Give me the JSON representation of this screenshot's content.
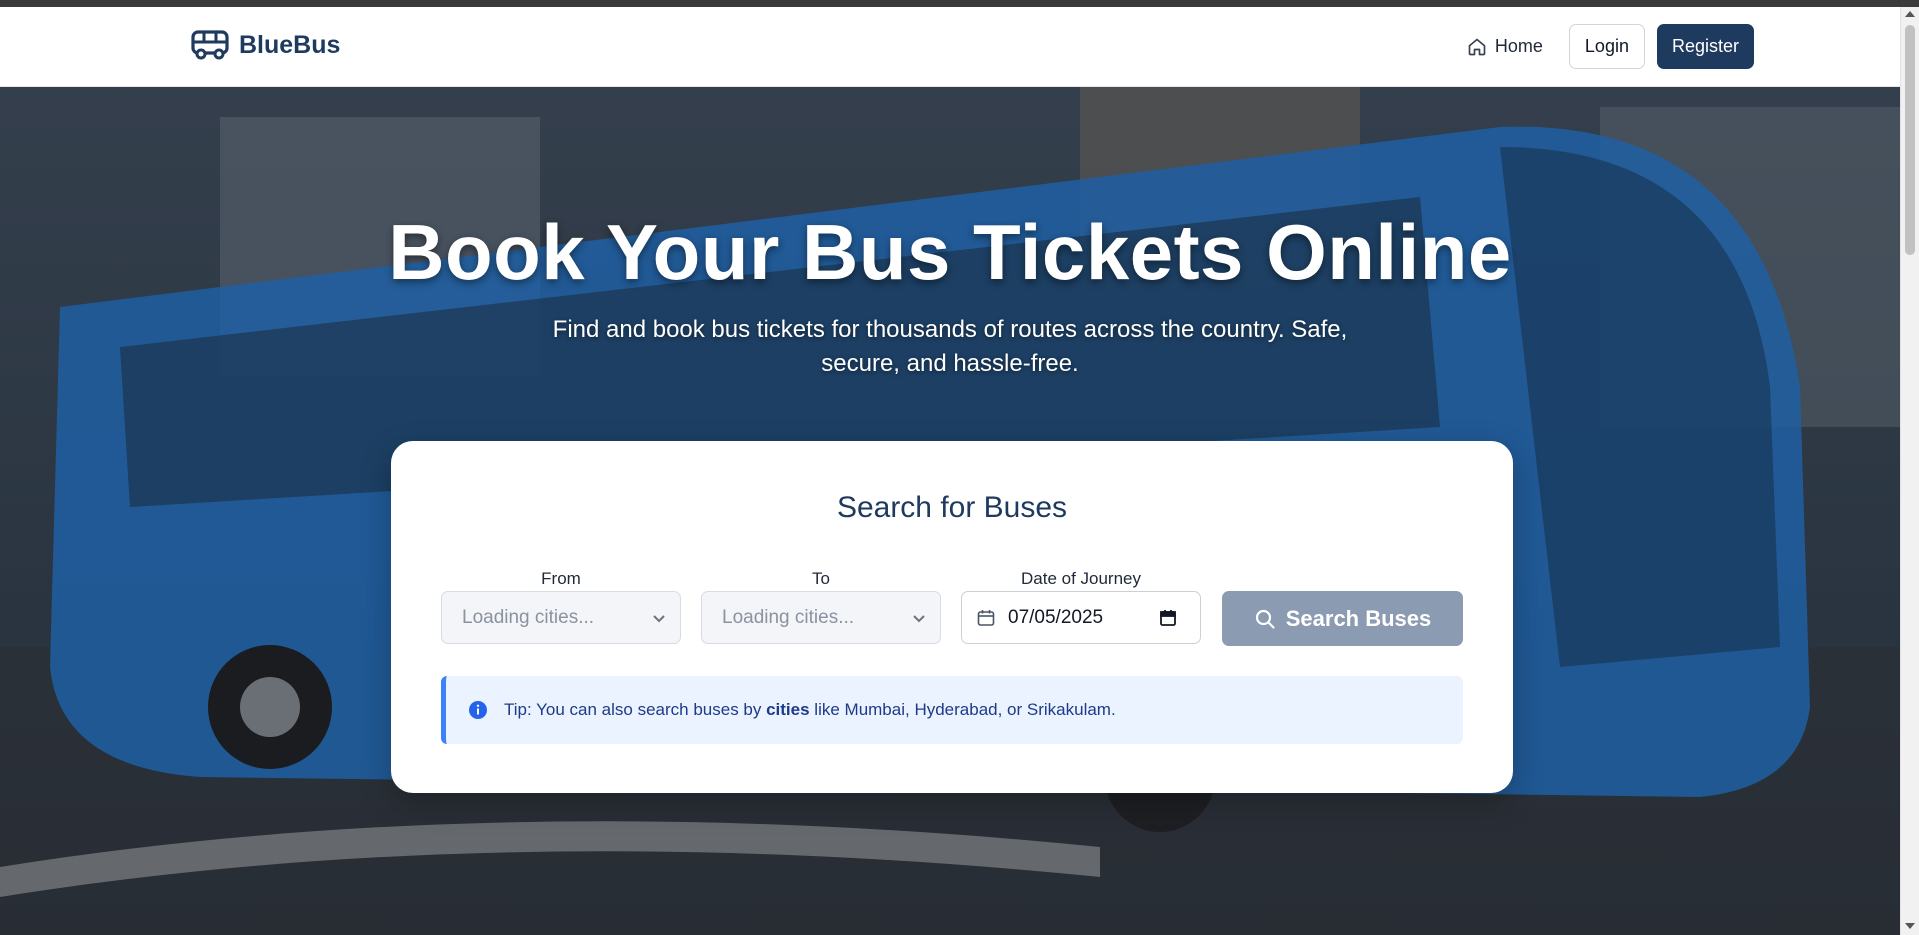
{
  "brand": {
    "name": "BlueBus",
    "icon": "bus-icon"
  },
  "nav": {
    "home_label": "Home",
    "login_label": "Login",
    "register_label": "Register"
  },
  "hero": {
    "title": "Book Your Bus Tickets Online",
    "subtitle": "Find and book bus tickets for thousands of routes across the country. Safe, secure, and hassle-free."
  },
  "search": {
    "title": "Search for Buses",
    "from_label": "From",
    "from_placeholder": "Loading cities...",
    "to_label": "To",
    "to_placeholder": "Loading cities...",
    "date_label": "Date of Journey",
    "date_value": "07/05/2025",
    "button_label": "Search Buses"
  },
  "tip": {
    "prefix": "Tip: You can also search buses by ",
    "emphasis": "cities",
    "suffix": " like Mumbai, Hyderabad, or Srikakulam."
  },
  "colors": {
    "brand": "#1e3a5f",
    "search_button": "#8b9bb1",
    "tip_bg": "#eaf3ff",
    "tip_border": "#3b82f6"
  }
}
